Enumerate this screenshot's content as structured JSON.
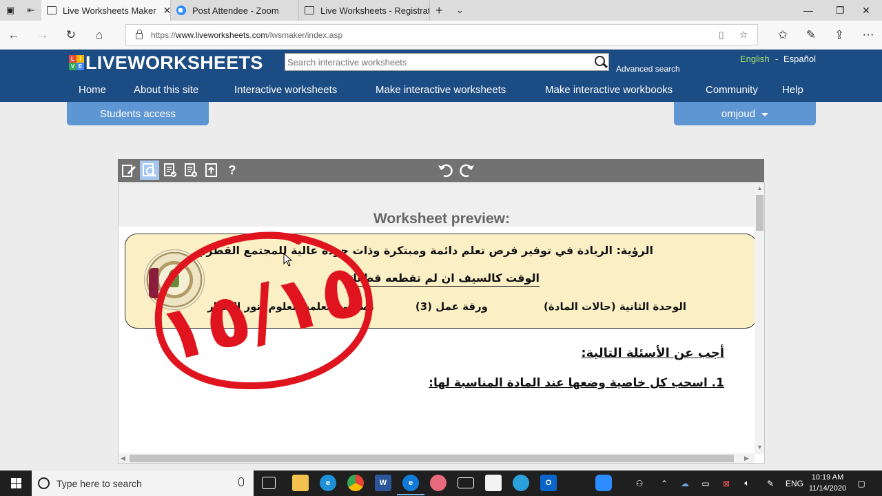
{
  "browser": {
    "tabs": [
      {
        "title": "Live Worksheets Maker",
        "active": true
      },
      {
        "title": "Post Attendee - Zoom",
        "active": false
      },
      {
        "title": "Live Worksheets - Registrati",
        "active": false
      }
    ],
    "url_prefix": "https://",
    "url_host": "www.liveworksheets.com",
    "url_path": "/lwsmaker/index.asp"
  },
  "site": {
    "logo_letters": [
      "L",
      "I",
      "V",
      "E"
    ],
    "logo_colors": [
      "#e84c3d",
      "#f4b400",
      "#34a853",
      "#4285f4"
    ],
    "logo_text": "LIVEWORKSHEETS",
    "search_placeholder": "Search interactive worksheets",
    "advanced_search": "Advanced search",
    "lang_en": "English",
    "lang_sep": "-",
    "lang_es": "Español",
    "menu": [
      "Home",
      "About this site",
      "Interactive worksheets",
      "Make interactive worksheets",
      "Make interactive workbooks",
      "Community",
      "Help"
    ],
    "students_access": "Students access",
    "user": "omjoud",
    "header_color": "#1b4c84",
    "accent_color": "#5d96d2",
    "lang_active_color": "#a6e36b"
  },
  "editor": {
    "help_label": "?",
    "preview_title": "Worksheet preview:"
  },
  "worksheet": {
    "vision": "الرؤية: الريادة في توفير فرص تعلم دائمة ومبتكرة وذات جودة عالية للمجتمع القطري",
    "motto": "الوقت كالسيف ان لم تقطعه قطعك",
    "unit": "الوحدة الثانية (حالات المادة)",
    "sheet": "ورقة عمل (3)",
    "designer": "تصميم: معلمة العلوم: نور العطار",
    "instruction": "أجب عن الأسئلة التالية:",
    "question1": "1. اسحب كل خاصية وضعها عند المادة المناسبة لها:",
    "score_stamp": "١٥/١٥",
    "stamp_color": "#e0141e"
  },
  "taskbar": {
    "search_placeholder": "Type here to search",
    "lang": "ENG",
    "time": "10:19 AM",
    "date": "11/14/2020"
  }
}
